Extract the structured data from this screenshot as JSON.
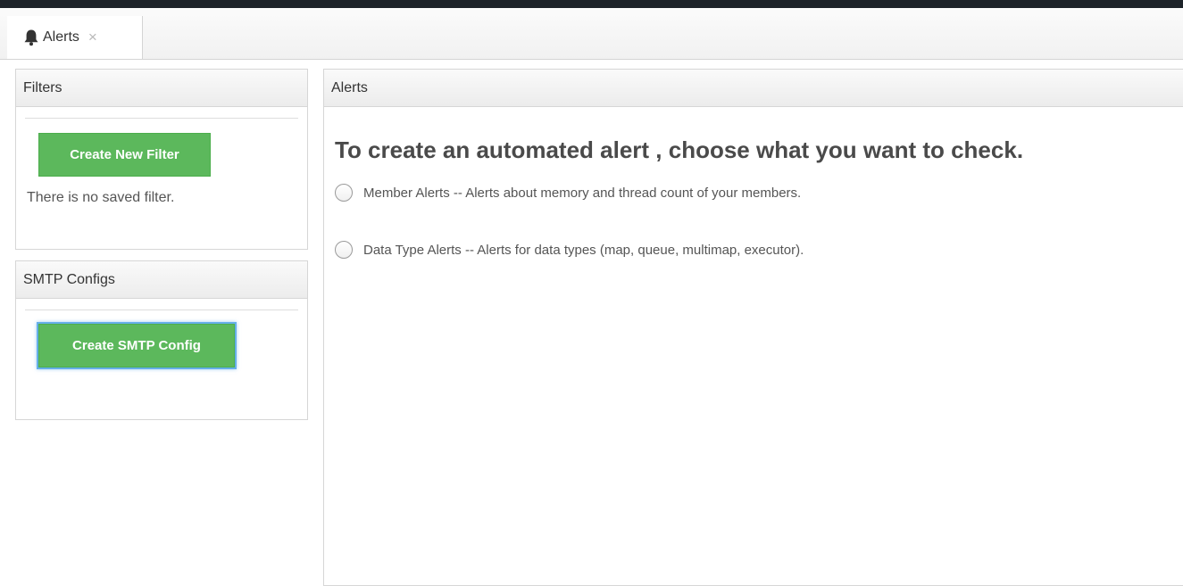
{
  "tab": {
    "label": "Alerts",
    "close_glyph": "×",
    "icon": "bell-icon"
  },
  "filters": {
    "title": "Filters",
    "create_button": "Create New Filter",
    "empty_text": "There is no saved filter."
  },
  "smtp": {
    "title": "SMTP Configs",
    "create_button": "Create SMTP Config"
  },
  "alerts": {
    "title": "Alerts",
    "heading": "To create an automated alert , choose what you want to check.",
    "options": [
      {
        "label": "Member Alerts -- Alerts about memory and thread count of your members."
      },
      {
        "label": "Data Type Alerts -- Alerts for data types (map, queue, multimap, executor)."
      }
    ]
  },
  "colors": {
    "top_bar": "#1d2329",
    "button_green": "#5cb85c",
    "focus_ring": "#66afe9"
  }
}
